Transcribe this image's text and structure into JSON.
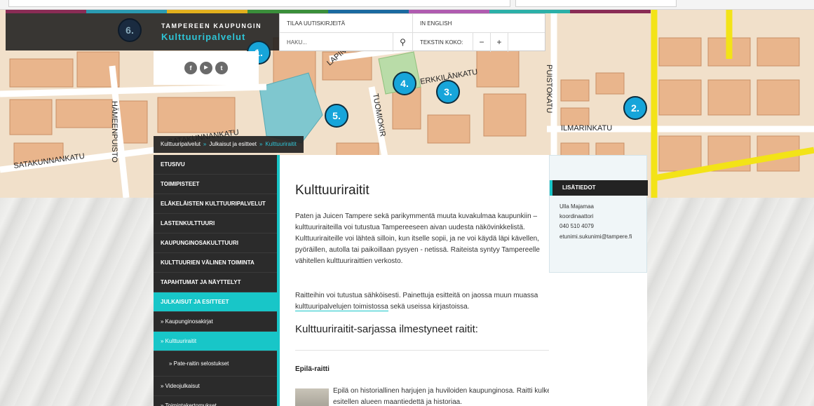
{
  "header": {
    "city": "TAMPEREEN KAUPUNGIN",
    "title": "Kulttuuripalvelut",
    "utility": {
      "newsletter": "TILAA UUTISKIRJEITÄ",
      "english": "IN ENGLISH",
      "search_placeholder": "HAKU...",
      "text_size_label": "TEKSTIN KOKO:",
      "decrease": "−",
      "increase": "+"
    },
    "stripe_colors": [
      "#8a2c55",
      "#2b9bb2",
      "#e2b01d",
      "#3a8f3a",
      "#1a6aa0",
      "#b05bb0",
      "#2bb0a8",
      "#8a2c55"
    ]
  },
  "social": {
    "icons": [
      "facebook-icon",
      "youtube-icon",
      "twitter-icon"
    ],
    "facebook": "f",
    "youtube": "▶",
    "twitter": "t"
  },
  "map": {
    "pins": [
      "2.",
      "3.",
      "4.",
      "5.",
      "6.",
      "1."
    ],
    "streets": [
      "ERKKILÄNKATU",
      "PUISTOKATU",
      "ILMARINKATU",
      "SATAKUNNANKATU",
      "HÄMEENPUISTO",
      "TUOMIOKIR",
      "LAPIN",
      "SATAKUNNANKATU"
    ]
  },
  "breadcrumb": {
    "items": [
      "Kulttuuripalvelut",
      "Julkaisut ja esitteet",
      "Kulttuuriraitit"
    ],
    "separator": "»"
  },
  "nav": {
    "items": [
      "ETUSIVU",
      "TOIMIPISTEET",
      "ELÄKELÄISTEN KULTTUURIPALVELUT",
      "LASTENKULTTUURI",
      "KAUPUNGINOSAKULTTUURI",
      "KULTTUURIEN VÄLINEN TOIMINTA",
      "TAPAHTUMAT JA NÄYTTELYT",
      "JULKAISUT JA ESITTEET"
    ],
    "sub": [
      "» Kaupunginosakirjat",
      "» Kulttuuriraitit",
      "» Pate-raitin selostukset",
      "» Videojulkaisut",
      "» Toimintakertomukset"
    ],
    "active_color": "#18c6c8"
  },
  "main": {
    "title": "Kulttuuriraitit",
    "paragraph1": "Paten ja Juicen Tampere sekä parikymmentä muuta kuvakulmaa kaupunkiin – kulttuuriraiteilla voi tutustua Tampereeseen aivan uudesta näkövinkkelistä. Kulttuuriraiteille voi lähteä silloin, kun itselle sopii, ja ne voi käydä läpi kävellen, pyöräillen, autolla tai paikoillaan pysyen - netissä. Raiteista syntyy Tampereelle vähitellen kulttuuriraittien verkosto.",
    "paragraph2_before": "Raitteihin voi tutustua sähköisesti. Painettuja esitteitä on jaossa muun muassa ",
    "paragraph2_link": "kulttuuripalvelujen toimistossa",
    "paragraph2_after": " sekä useissa kirjastoissa.",
    "series_heading": "Kulttuuriraitit-sarjassa ilmestyneet raitit:",
    "epila_heading": "Epilä-raitti",
    "epila_text": "Epilä on historiallinen harjujen ja huviloiden kaupunginosa. Raitti kulkee asuinalueen läpi esitellen alueen maantiedettä ja historiaa."
  },
  "info": {
    "heading": "LISÄTIEDOT",
    "name": "Ulla Majamaa",
    "role": "koordinaattori",
    "phone": "040 510 4079",
    "email": "etunimi.sukunimi@tampere.fi"
  }
}
